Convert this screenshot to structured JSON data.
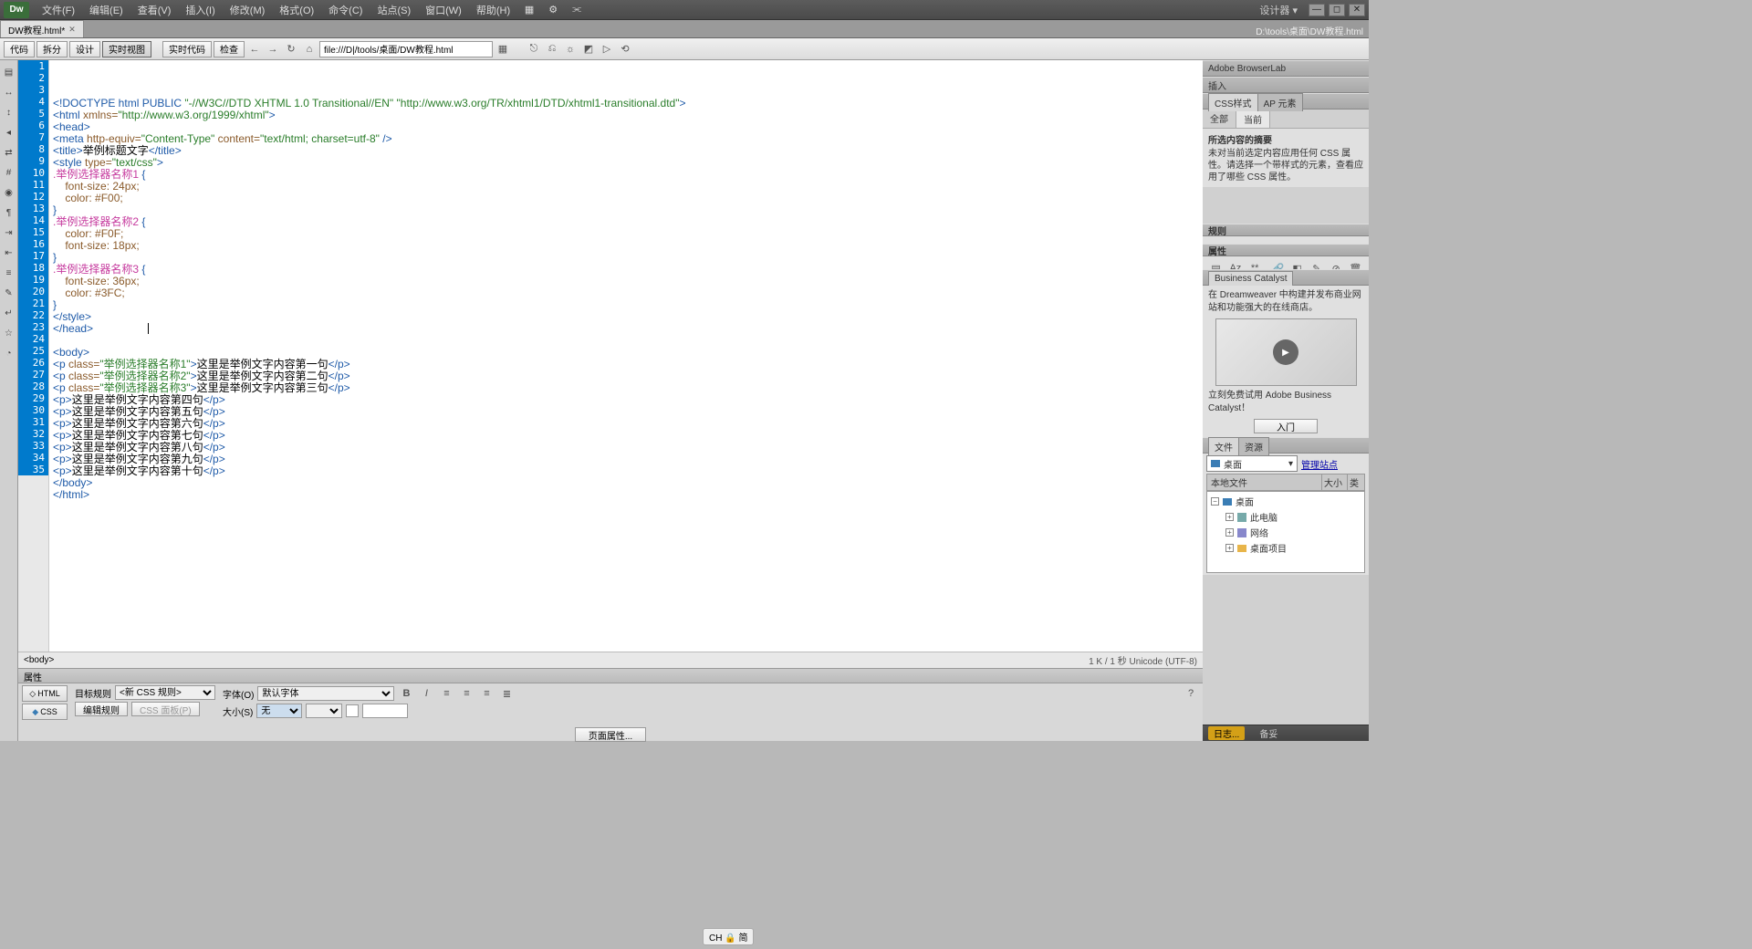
{
  "app": {
    "logo": "Dw"
  },
  "menu": [
    "文件(F)",
    "编辑(E)",
    "查看(V)",
    "插入(I)",
    "修改(M)",
    "格式(O)",
    "命令(C)",
    "站点(S)",
    "窗口(W)",
    "帮助(H)"
  ],
  "top_right": "设计器 ▾",
  "document_tab": {
    "title": "DW教程.html*",
    "path": "D:\\tools\\桌面\\DW教程.html"
  },
  "toolbar": {
    "buttons": [
      "代码",
      "拆分",
      "设计",
      "实时视图"
    ],
    "live_code": "实时代码",
    "check": "检查",
    "url": "file:///D|/tools/桌面/DW教程.html"
  },
  "code_lines": [
    [
      [
        "blue",
        "<!DOCTYPE html PUBLIC "
      ],
      [
        "green",
        "\"-//W3C//DTD XHTML 1.0 Transitional//EN\""
      ],
      [
        "blue",
        " "
      ],
      [
        "green",
        "\"http://www.w3.org/TR/xhtml1/DTD/xhtml1-transitional.dtd\""
      ],
      [
        "blue",
        ">"
      ]
    ],
    [
      [
        "blue",
        "<html "
      ],
      [
        "brown",
        "xmlns="
      ],
      [
        "green",
        "\"http://www.w3.org/1999/xhtml\""
      ],
      [
        "blue",
        ">"
      ]
    ],
    [
      [
        "blue",
        "<head>"
      ]
    ],
    [
      [
        "blue",
        "<meta "
      ],
      [
        "brown",
        "http-equiv="
      ],
      [
        "green",
        "\"Content-Type\""
      ],
      [
        "brown",
        " content="
      ],
      [
        "green",
        "\"text/html; charset=utf-8\""
      ],
      [
        "blue",
        " />"
      ]
    ],
    [
      [
        "blue",
        "<title>"
      ],
      [
        "text",
        "举例标题文字"
      ],
      [
        "blue",
        "</title>"
      ]
    ],
    [
      [
        "blue",
        "<style "
      ],
      [
        "brown",
        "type="
      ],
      [
        "green",
        "\"text/css\""
      ],
      [
        "blue",
        ">"
      ]
    ],
    [
      [
        "pink",
        ".举例选择器名称1 "
      ],
      [
        "blue",
        "{"
      ]
    ],
    [
      [
        "text",
        "    "
      ],
      [
        "brown",
        "font-size: 24px;"
      ]
    ],
    [
      [
        "text",
        "    "
      ],
      [
        "brown",
        "color: #F00;"
      ]
    ],
    [
      [
        "blue",
        "}"
      ]
    ],
    [
      [
        "pink",
        ".举例选择器名称2 "
      ],
      [
        "blue",
        "{"
      ]
    ],
    [
      [
        "text",
        "    "
      ],
      [
        "brown",
        "color: #F0F;"
      ]
    ],
    [
      [
        "text",
        "    "
      ],
      [
        "brown",
        "font-size: 18px;"
      ]
    ],
    [
      [
        "blue",
        "}"
      ]
    ],
    [
      [
        "pink",
        ".举例选择器名称3 "
      ],
      [
        "blue",
        "{"
      ]
    ],
    [
      [
        "text",
        "    "
      ],
      [
        "brown",
        "font-size: 36px;"
      ]
    ],
    [
      [
        "text",
        "    "
      ],
      [
        "brown",
        "color: #3FC;"
      ]
    ],
    [
      [
        "blue",
        "}"
      ]
    ],
    [
      [
        "blue",
        "</style>"
      ]
    ],
    [
      [
        "blue",
        "</head>"
      ]
    ],
    [
      [
        "text",
        ""
      ]
    ],
    [
      [
        "blue",
        "<body>"
      ]
    ],
    [
      [
        "blue",
        "<p "
      ],
      [
        "brown",
        "class="
      ],
      [
        "green",
        "\"举例选择器名称1\""
      ],
      [
        "blue",
        ">"
      ],
      [
        "text",
        "这里是举例文字内容第一句"
      ],
      [
        "blue",
        "</p>"
      ]
    ],
    [
      [
        "blue",
        "<p "
      ],
      [
        "brown",
        "class="
      ],
      [
        "green",
        "\"举例选择器名称2\""
      ],
      [
        "blue",
        ">"
      ],
      [
        "text",
        "这里是举例文字内容第二句"
      ],
      [
        "blue",
        "</p>"
      ]
    ],
    [
      [
        "blue",
        "<p "
      ],
      [
        "brown",
        "class="
      ],
      [
        "green",
        "\"举例选择器名称3\""
      ],
      [
        "blue",
        ">"
      ],
      [
        "text",
        "这里是举例文字内容第三句"
      ],
      [
        "blue",
        "</p>"
      ]
    ],
    [
      [
        "blue",
        "<p>"
      ],
      [
        "text",
        "这里是举例文字内容第四句"
      ],
      [
        "blue",
        "</p>"
      ]
    ],
    [
      [
        "blue",
        "<p>"
      ],
      [
        "text",
        "这里是举例文字内容第五句"
      ],
      [
        "blue",
        "</p>"
      ]
    ],
    [
      [
        "blue",
        "<p>"
      ],
      [
        "text",
        "这里是举例文字内容第六句"
      ],
      [
        "blue",
        "</p>"
      ]
    ],
    [
      [
        "blue",
        "<p>"
      ],
      [
        "text",
        "这里是举例文字内容第七句"
      ],
      [
        "blue",
        "</p>"
      ]
    ],
    [
      [
        "blue",
        "<p>"
      ],
      [
        "text",
        "这里是举例文字内容第八句"
      ],
      [
        "blue",
        "</p>"
      ]
    ],
    [
      [
        "blue",
        "<p>"
      ],
      [
        "text",
        "这里是举例文字内容第九句"
      ],
      [
        "blue",
        "</p>"
      ]
    ],
    [
      [
        "blue",
        "<p>"
      ],
      [
        "text",
        "这里是举例文字内容第十句"
      ],
      [
        "blue",
        "</p>"
      ]
    ],
    [
      [
        "blue",
        "</body>"
      ]
    ],
    [
      [
        "blue",
        "</html>"
      ]
    ],
    [
      [
        "text",
        ""
      ]
    ]
  ],
  "tag_selector": "<body>",
  "status_code": "1 K / 1 秒 Unicode (UTF-8)",
  "properties": {
    "title": "属性",
    "mode_html": "HTML",
    "mode_css": "CSS",
    "target_rule_label": "目标规则",
    "target_rule_value": "<新 CSS 规则>",
    "edit_rule": "编辑规则",
    "css_panel": "CSS 面板(P)",
    "font_label": "字体(O)",
    "font_value": "默认字体",
    "size_label": "大小(S)",
    "size_value": "无",
    "page_props": "页面属性..."
  },
  "ime_pill": "CH 🔒 简",
  "right": {
    "browserlab": "Adobe BrowserLab",
    "insert": "插入",
    "css_tab1": "CSS样式",
    "css_tab2": "AP 元素",
    "css_sub1": "全部",
    "css_sub2": "当前",
    "css_summary_title": "所选内容的摘要",
    "css_summary_text": "未对当前选定内容应用任何 CSS 属性。请选择一个带样式的元素，查看应用了哪些 CSS 属性。",
    "rules_title": "规则",
    "props_title": "属性",
    "bc_title": "Business Catalyst",
    "bc_text1": "在 Dreamweaver 中构建并发布商业网站和功能强大的在线商店。",
    "bc_text2": "立刻免费试用 Adobe Business Catalyst！",
    "bc_btn": "入门",
    "files_tab1": "文件",
    "files_tab2": "资源",
    "site_drop": "桌面",
    "manage_site": "管理站点",
    "col_local": "本地文件",
    "col_size": "大小",
    "col_type": "类",
    "tree": [
      "桌面",
      "此电脑",
      "网络",
      "桌面项目"
    ],
    "statusbar": [
      "日志...",
      "备妥"
    ]
  }
}
